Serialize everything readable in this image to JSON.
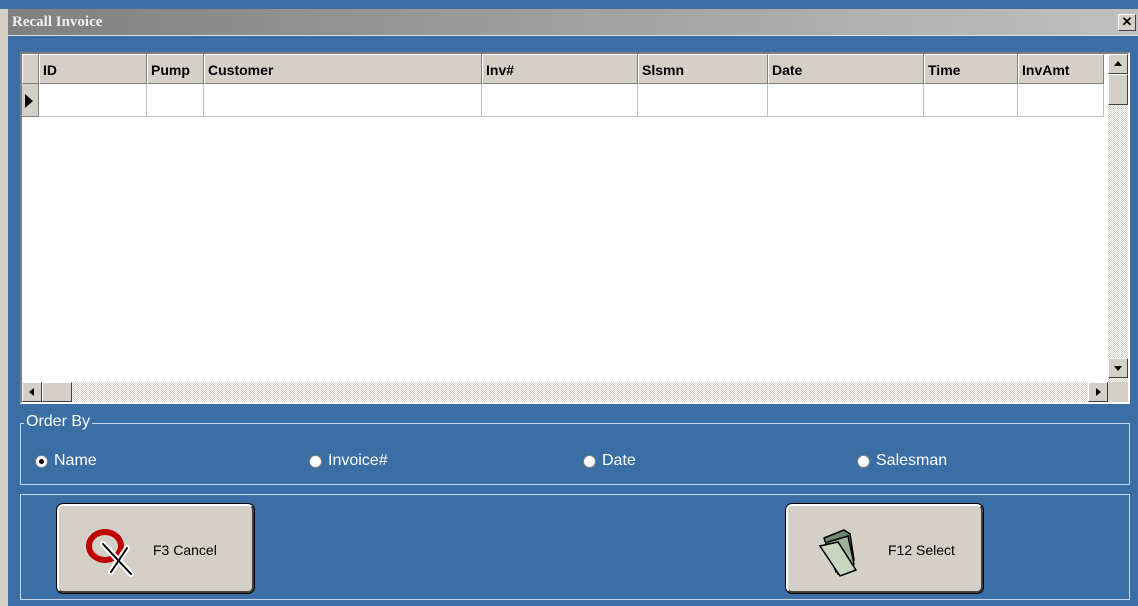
{
  "window": {
    "title": "Recall Invoice",
    "close_glyph": "✕"
  },
  "grid": {
    "columns": [
      "ID",
      "Pump",
      "Customer",
      "Inv#",
      "Slsmn",
      "Date",
      "Time",
      "InvAmt"
    ],
    "rows": [
      [
        "",
        "",
        "",
        "",
        "",
        "",
        "",
        ""
      ]
    ]
  },
  "order_by": {
    "legend": "Order By",
    "options": [
      "Name",
      "Invoice#",
      "Date",
      "Salesman"
    ],
    "selected": "Name"
  },
  "buttons": {
    "cancel": "F3 Cancel",
    "select": "F12 Select"
  },
  "icons": {
    "cancel": "cancel-x-circle-icon",
    "select": "folder-icon"
  },
  "colors": {
    "background": "#3a6ea5",
    "title_gradient_start": "#808080"
  }
}
